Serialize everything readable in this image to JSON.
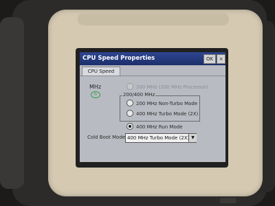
{
  "window": {
    "title": "CPU Speed Properties",
    "ok_label": "OK",
    "close_label": "×"
  },
  "tab": {
    "label": "CPU Speed"
  },
  "mhz_label": "MHz",
  "options": {
    "opt_200_proc": "200 MHz (200 MHz Processor)",
    "group_label": "200/400 MHz",
    "opt_200_nonturbo": "200 MHz Non-Turbo Mode",
    "opt_400_turbo": "400 MHz Turbo Mode (2X)",
    "opt_400_run": "400 MHz Run Mode",
    "selected": "opt_400_run"
  },
  "cold_boot": {
    "label": "Cold Boot Mode",
    "value": "400 MHz Turbo Mode (2X)"
  },
  "icons": {
    "mhz_icon": "speed-icon",
    "dropdown_arrow": "chevron-down-icon"
  },
  "colors": {
    "titlebar": "#1c2f6b",
    "dialog_bg": "#b8bbc2",
    "bezel": "#d5c9b2"
  }
}
